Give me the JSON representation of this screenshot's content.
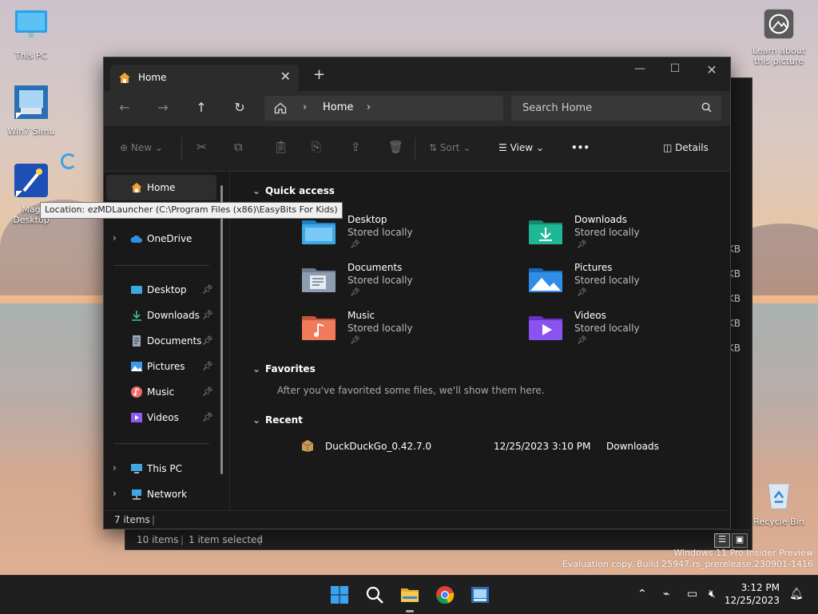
{
  "desktop": {
    "icons": [
      {
        "label": "This PC"
      },
      {
        "label": "Win7 Simu"
      },
      {
        "label_line1": "Mag",
        "label_line2": "Desktop"
      },
      {
        "label": "Learn about this picture"
      },
      {
        "label": "Recycle Bin"
      }
    ],
    "watermark_line1": "Windows 11 Pro Insider Preview",
    "watermark_line2": "Evaluation copy. Build 25947.rs_prerelease.230901-1416"
  },
  "tooltip": "Location: ezMDLauncher (C:\\Program Files (x86)\\EasyBits For Kids)",
  "bg_window": {
    "status_items": "10 items",
    "status_selected": "1 item selected",
    "sizes": [
      "KB",
      "KB",
      "KB",
      "KB",
      "KB"
    ]
  },
  "window": {
    "tab_title": "Home",
    "tab_close": "✕",
    "new_tab": "+",
    "controls": {
      "minimize": "—",
      "maximize": "☐",
      "close": "✕"
    },
    "nav": {
      "back": "←",
      "forward": "→",
      "up": "↑",
      "refresh": "↻"
    },
    "address": {
      "crumb": "Home",
      "sep": "›"
    },
    "search": {
      "placeholder": "Search Home"
    },
    "toolbar": {
      "new": "New",
      "sort": "Sort",
      "view": "View",
      "more": "•••",
      "details": "Details"
    },
    "sidebar": {
      "home": "Home",
      "onedrive": "OneDrive",
      "pinned": [
        {
          "label": "Desktop",
          "color": "#3fa7e4"
        },
        {
          "label": "Downloads",
          "color": "#3cc4a0"
        },
        {
          "label": "Documents",
          "color": "#9aa7b8"
        },
        {
          "label": "Pictures",
          "color": "#3b9be8"
        },
        {
          "label": "Music",
          "color": "#f06a6a"
        },
        {
          "label": "Videos",
          "color": "#8d5cf0"
        }
      ],
      "this_pc": "This PC",
      "network": "Network"
    },
    "content": {
      "quick_access": "Quick access",
      "favorites": "Favorites",
      "favorites_msg": "After you've favorited some files, we'll show them here.",
      "recent": "Recent",
      "stored_locally": "Stored locally",
      "folders": [
        {
          "name": "Desktop",
          "color": "#3fa7e4"
        },
        {
          "name": "Downloads",
          "color": "#1fb896"
        },
        {
          "name": "Documents",
          "color": "#8e9db2"
        },
        {
          "name": "Pictures",
          "color": "#2f8fe8"
        },
        {
          "name": "Music",
          "color": "#f07a5a"
        },
        {
          "name": "Videos",
          "color": "#8a52ee"
        }
      ],
      "recent_file": {
        "name": "DuckDuckGo_0.42.7.0",
        "date": "12/25/2023 3:10 PM",
        "location": "Downloads"
      }
    },
    "status": {
      "items": "7 items",
      "sep": "|"
    }
  },
  "taskbar": {
    "time": "3:12 PM",
    "date": "12/25/2023"
  }
}
